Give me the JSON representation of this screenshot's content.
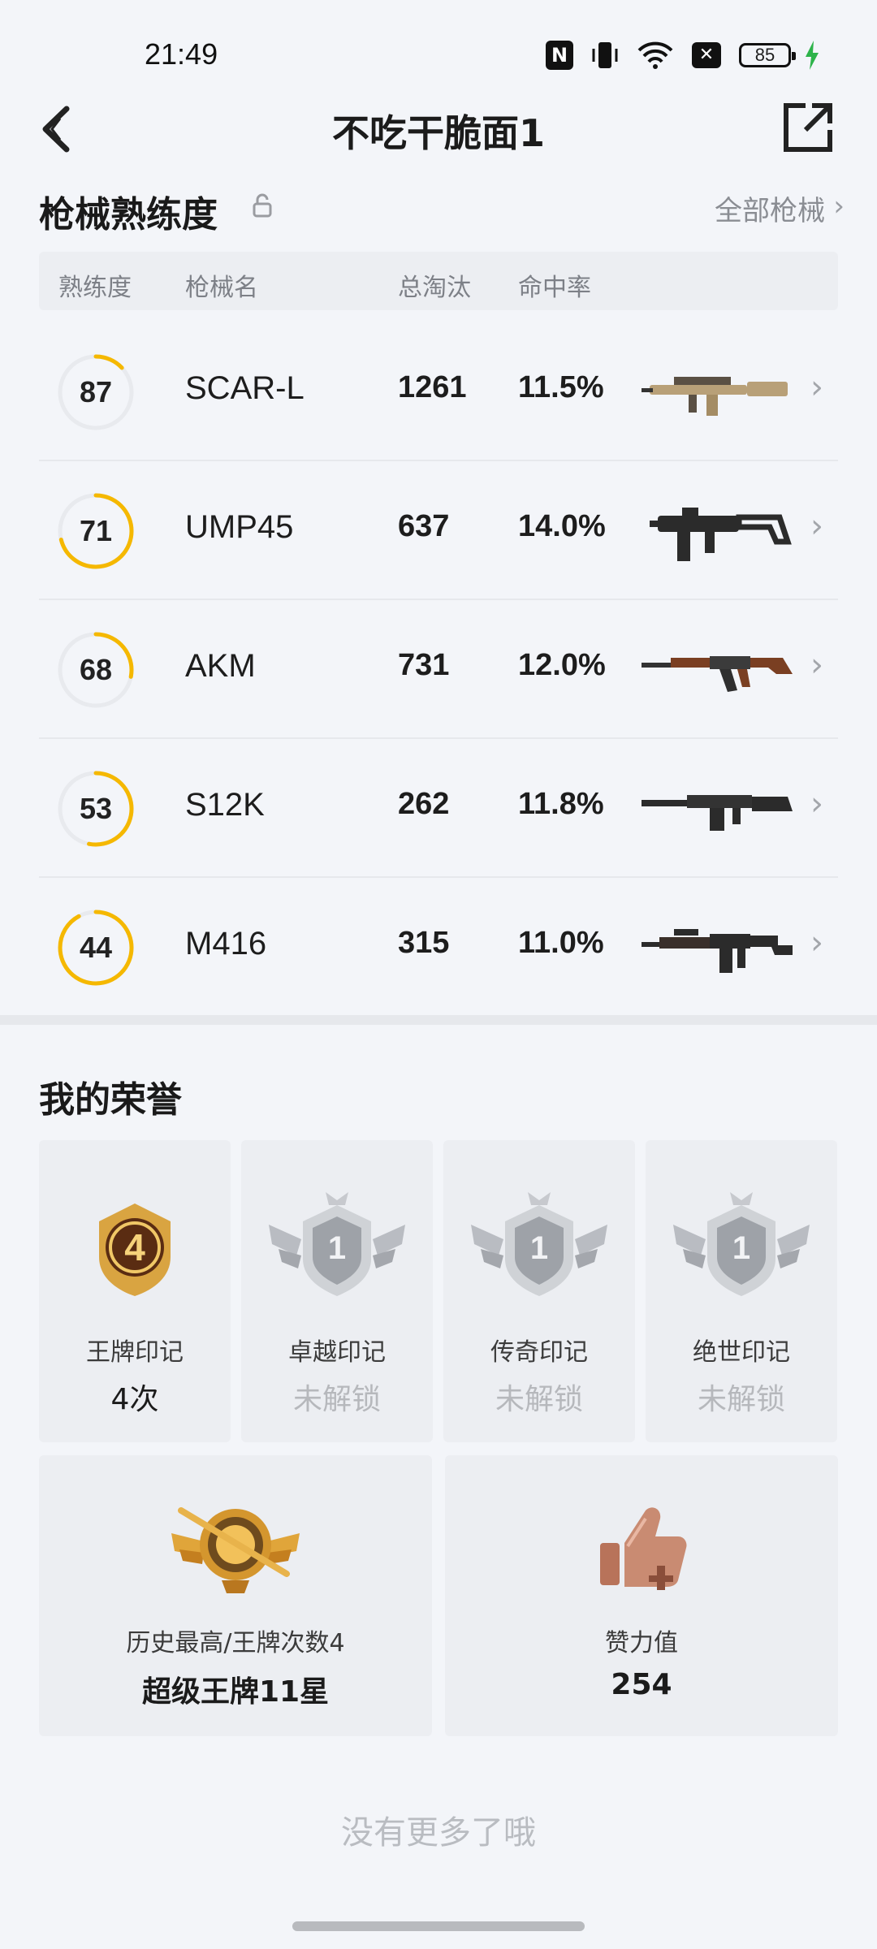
{
  "status_bar": {
    "time": "21:49",
    "battery": "85",
    "icons": [
      "nfc-icon",
      "vibrate-icon",
      "wifi-icon",
      "no-sim-icon",
      "battery-icon",
      "charging-icon"
    ]
  },
  "header": {
    "title": "不吃干脆面1",
    "back_icon": "back-arrow-icon",
    "share_icon": "share-external-icon"
  },
  "weapons": {
    "section_title": "枪械熟练度",
    "all_label": "全部枪械",
    "columns": [
      "熟练度",
      "枪械名",
      "总淘汰",
      "命中率"
    ],
    "rows": [
      {
        "proficiency": "87",
        "level": 0.13,
        "name": "SCAR-L",
        "kills": "1261",
        "hit_rate": "11.5%",
        "image": "scar-l-rifle"
      },
      {
        "proficiency": "71",
        "level": 0.71,
        "name": "UMP45",
        "kills": "637",
        "hit_rate": "14.0%",
        "image": "ump45-smg"
      },
      {
        "proficiency": "68",
        "level": 0.28,
        "name": "AKM",
        "kills": "731",
        "hit_rate": "12.0%",
        "image": "akm-rifle"
      },
      {
        "proficiency": "53",
        "level": 0.53,
        "name": "S12K",
        "kills": "262",
        "hit_rate": "11.8%",
        "image": "s12k-shotgun"
      },
      {
        "proficiency": "44",
        "level": 0.92,
        "name": "M416",
        "kills": "315",
        "hit_rate": "11.0%",
        "image": "m416-rifle"
      }
    ],
    "accent_color": "#f5b800"
  },
  "honors": {
    "section_title": "我的荣誉",
    "marks": [
      {
        "label": "王牌印记",
        "value": "4次",
        "badge_number": "4",
        "locked": false
      },
      {
        "label": "卓越印记",
        "value": "未解锁",
        "badge_number": "1",
        "locked": true
      },
      {
        "label": "传奇印记",
        "value": "未解锁",
        "badge_number": "1",
        "locked": true
      },
      {
        "label": "绝世印记",
        "value": "未解锁",
        "badge_number": "1",
        "locked": true
      }
    ],
    "highest": {
      "label": "历史最高/王牌次数4",
      "value": "超级王牌11星"
    },
    "likes": {
      "label": "赞力值",
      "value": "254"
    }
  },
  "footer": {
    "text": "没有更多了哦"
  }
}
